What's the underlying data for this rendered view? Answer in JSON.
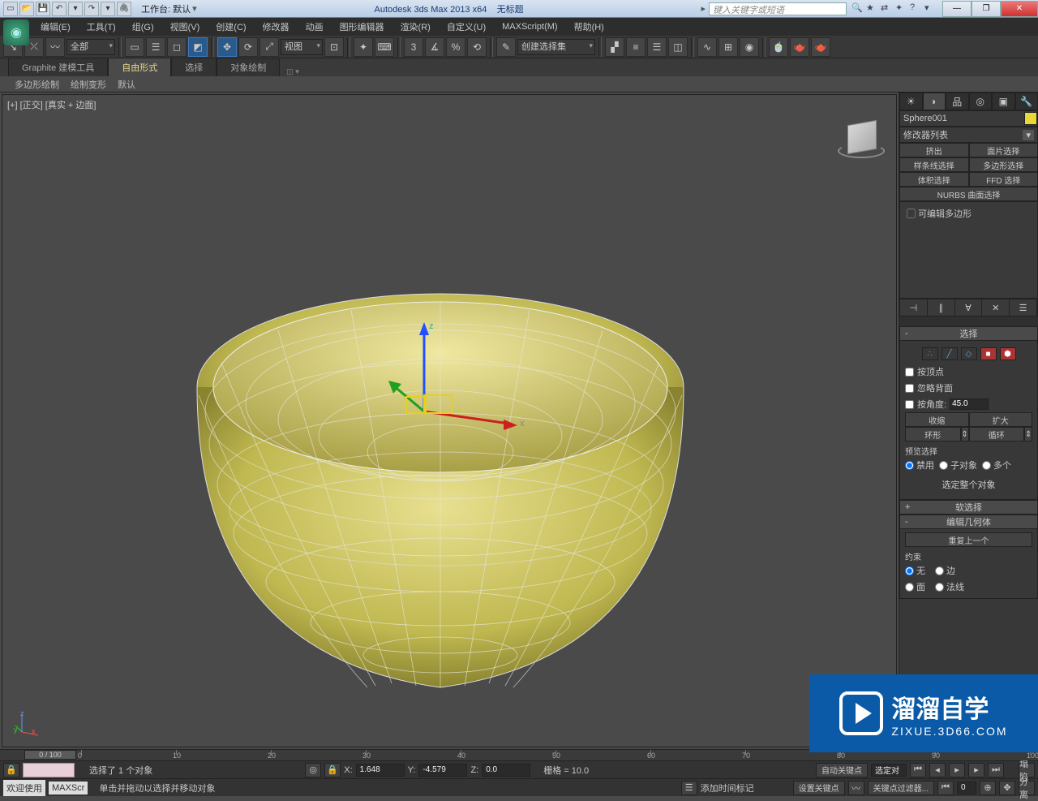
{
  "titlebar": {
    "workspace_label": "工作台: 默认",
    "app_title": "Autodesk 3ds Max  2013 x64",
    "doc_title": "无标题",
    "search_placeholder": "键入关键字或短语"
  },
  "menu": {
    "items": [
      "编辑(E)",
      "工具(T)",
      "组(G)",
      "视图(V)",
      "创建(C)",
      "修改器",
      "动画",
      "图形编辑器",
      "渲染(R)",
      "自定义(U)",
      "MAXScript(M)",
      "帮助(H)"
    ]
  },
  "toolbar_main": {
    "selection_filter": "全部",
    "view_dd": "视图",
    "named_sel": "创建选择集"
  },
  "ribbon": {
    "tabs": [
      "Graphite 建模工具",
      "自由形式",
      "选择",
      "对象绘制"
    ],
    "active": 1,
    "sub": [
      "多边形绘制",
      "绘制变形",
      "默认"
    ]
  },
  "viewport": {
    "label": "[+] [正交] [真实 + 边面]",
    "axes": {
      "x": "x",
      "y": "y",
      "z": "z"
    }
  },
  "cmdpanel": {
    "object_name": "Sphere001",
    "modlist_label": "修改器列表",
    "mod_buttons": [
      [
        "挤出",
        "面片选择"
      ],
      [
        "样条线选择",
        "多边形选择"
      ],
      [
        "体积选择",
        "FFD 选择"
      ]
    ],
    "nurbs_btn": "NURBS 曲面选择",
    "stack_item": "可编辑多边形",
    "roll_selection": "选择",
    "chk_byvertex": "按顶点",
    "chk_ignoreback": "忽略背面",
    "chk_byangle": "按角度:",
    "angle_val": "45.0",
    "btn_shrink": "收缩",
    "btn_grow": "扩大",
    "btn_ring": "环形",
    "btn_loop": "循环",
    "preview_label": "预览选择",
    "rad_disable": "禁用",
    "rad_subobj": "子对象",
    "rad_multi": "多个",
    "sel_whole": "选定整个对象",
    "roll_soft": "软选择",
    "roll_editgeo": "编辑几何体",
    "btn_repeat": "重复上一个",
    "constraint_label": "约束",
    "rad_none": "无",
    "rad_edge": "边",
    "rad_face": "面",
    "rad_normal": "法线",
    "cave_label": "塌陷",
    "split_label": "分离"
  },
  "timeline": {
    "slider": "0 / 100",
    "ticks": [
      0,
      10,
      20,
      30,
      40,
      50,
      60,
      70,
      80,
      90,
      100
    ]
  },
  "status1": {
    "sel_text": "选择了 1 个对象",
    "x_label": "X:",
    "x_val": "1.648",
    "y_label": "Y:",
    "y_val": "-4.579",
    "z_label": "Z:",
    "z_val": "0.0",
    "grid_label": "栅格 = 10.0",
    "autokey": "自动关键点",
    "selset": "选定对"
  },
  "status2": {
    "welcome": "欢迎使用",
    "maxscr": "MAXScr",
    "hint": "单击并拖动以选择并移动对象",
    "addtime": "添加时间标记",
    "setkey": "设置关键点",
    "keyfilter": "关键点过滤器..."
  },
  "watermark": {
    "t1": "溜溜自学",
    "t2": "ZIXUE.3D66.COM"
  }
}
